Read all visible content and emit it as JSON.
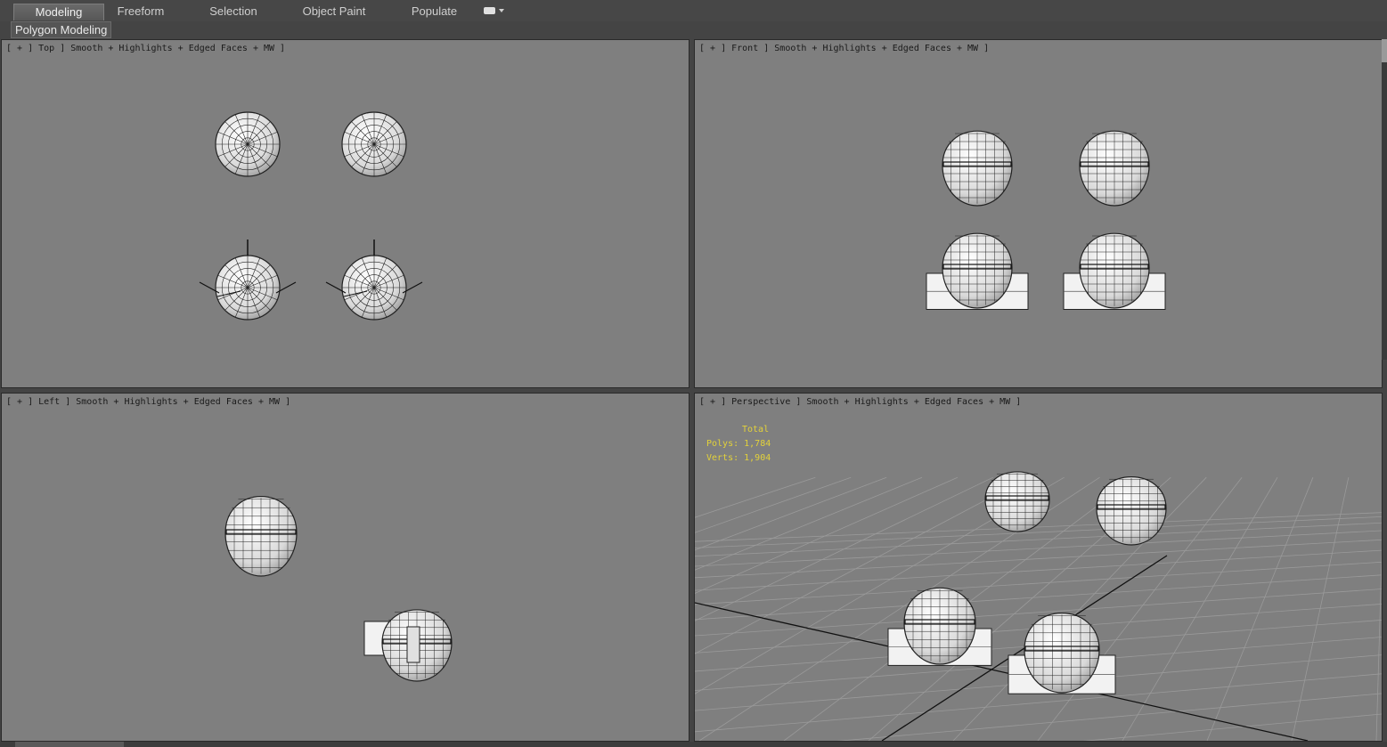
{
  "ribbon": {
    "tabs": [
      {
        "label": "Modeling",
        "active": true
      },
      {
        "label": "Freeform",
        "active": false
      },
      {
        "label": "Selection",
        "active": false
      },
      {
        "label": "Object Paint",
        "active": false
      },
      {
        "label": "Populate",
        "active": false
      }
    ],
    "menu_icon": "dropdown-menu-icon"
  },
  "panel": {
    "label": "Polygon Modeling"
  },
  "viewports": {
    "top": {
      "label": "[ + ] Top ] Smooth + Highlights + Edged Faces + MW ]"
    },
    "front": {
      "label": "[ + ] Front ] Smooth + Highlights + Edged Faces + MW ]"
    },
    "left": {
      "label": "[ + ] Left ] Smooth + Highlights + Edged Faces + MW ]"
    },
    "perspective": {
      "label": "[ + ] Perspective ] Smooth + Highlights + Edged Faces + MW ]"
    }
  },
  "stats": {
    "total_label": "Total",
    "polys": "Polys: 1,784",
    "verts": "Verts: 1,904"
  },
  "colors": {
    "viewport_bg": "#7f7f7f",
    "ui_bg": "#444444",
    "stats_text": "#e3d23a"
  }
}
